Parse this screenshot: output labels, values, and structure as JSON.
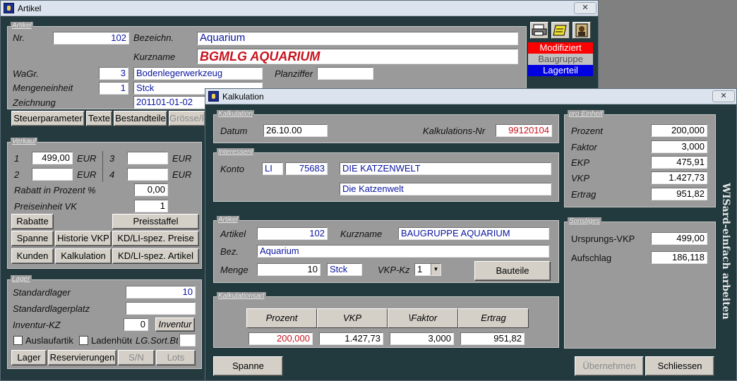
{
  "artikel_window": {
    "title": "Artikel",
    "close": "✕",
    "group_artikel": "Artikel",
    "nr_label": "Nr.",
    "nr_value": "102",
    "bezeichn_label": "Bezeichn.",
    "bezeichn_value": "Aquarium",
    "kurzname_label": "Kurzname",
    "kurzname_value": "BGMLG AQUARIUM",
    "wagr_label": "WaGr.",
    "wagr_value": "3",
    "wagr_text": "Bodenlegerwerkzeug",
    "planziffer_label": "Planziffer",
    "planziffer_value": "",
    "mengeneinheit_label": "Mengeneinheit",
    "mengeneinheit_value": "1",
    "mengeneinheit_text": "Stck",
    "zeichnung_label": "Zeichnung",
    "zeichnung_value": "201101-01-02",
    "tabs": [
      "Steuerparameter",
      "Texte",
      "Bestandteile",
      "Grösse/F"
    ],
    "status": {
      "modifiziert": "Modifiziert",
      "baugruppe": "Baugruppe",
      "lagerteil": "Lagerteil"
    },
    "verkauf": {
      "legend": "Verkauf",
      "p1_label": "1",
      "p1_value": "499,00",
      "p1_unit": "EUR",
      "p2_label": "2",
      "p2_value": "",
      "p2_unit": "EUR",
      "p3_label": "3",
      "p3_value": "",
      "p3_unit": "EUR",
      "p4_label": "4",
      "p4_value": "",
      "p4_unit": "EUR",
      "rabatt_label": "Rabatt in Prozent %",
      "rabatt_value": "0,00",
      "preiseinheit_label": "Preiseinheit VK",
      "preiseinheit_value": "1",
      "buttons": {
        "rabatte": "Rabatte",
        "preisstaffel": "Preisstaffel",
        "spanne": "Spanne",
        "historie": "Historie VKP",
        "kdli_preise": "KD/LI-spez. Preise",
        "kunden": "Kunden",
        "kalkulation": "Kalkulation",
        "kdli_artikel": "KD/LI-spez. Artikel"
      }
    },
    "lager": {
      "legend": "Lager",
      "standardlager_label": "Standardlager",
      "standardlager_value": "10",
      "lagerplatz_label": "Standardlagerplatz",
      "lagerplatz_value": "",
      "inventur_kz_label": "Inventur-KZ",
      "inventur_kz_value": "0",
      "inventur_button": "Inventur",
      "auslauf_label": "Auslaufartik",
      "ladenhueter_label": "Ladenhüte",
      "lgsort_label": "LG.Sort.Bt",
      "buttons": {
        "lager": "Lager",
        "reservierungen": "Reservierungen",
        "sn": "S/N",
        "lots": "Lots"
      }
    }
  },
  "kalkulation_window": {
    "title": "Kalkulation",
    "close": "✕",
    "kalk_group": {
      "legend": "Kalkulation",
      "datum_label": "Datum",
      "datum_value": "26.10.00",
      "nr_label": "Kalkulations-Nr",
      "nr_value": "99120104"
    },
    "interessent": {
      "legend": "Interessent",
      "konto_label": "Konto",
      "konto_prefix": "LI",
      "konto_nr": "75683",
      "name1": "DIE KATZENWELT",
      "name2": "Die Katzenwelt"
    },
    "artikel": {
      "legend": "Artikel",
      "artikel_label": "Artikel",
      "artikel_value": "102",
      "kurzname_label": "Kurzname",
      "kurzname_value": "BAUGRUPPE AQUARIUM",
      "bez_label": "Bez.",
      "bez_value": "Aquarium",
      "menge_label": "Menge",
      "menge_value": "10",
      "menge_unit": "Stck",
      "vkpkz_label": "VKP-Kz",
      "vkpkz_value": "1",
      "bauteile_button": "Bauteile"
    },
    "kalkart": {
      "legend": "Kalkulationsart",
      "headers": [
        "Prozent",
        "VKP",
        "\\Faktor",
        "Ertrag"
      ],
      "values": [
        "200,000",
        "1.427,73",
        "3,000",
        "951,82"
      ]
    },
    "pro_einheit": {
      "legend": "pro Einheit",
      "rows": [
        {
          "label": "Prozent",
          "value": "200,000"
        },
        {
          "label": "Faktor",
          "value": "3,000"
        },
        {
          "label": "EKP",
          "value": "475,91"
        },
        {
          "label": "VKP",
          "value": "1.427,73"
        },
        {
          "label": "Ertrag",
          "value": "951,82"
        }
      ]
    },
    "sonstiges": {
      "legend": "Sonstiges",
      "ursprung_label": "Ursprungs-VKP",
      "ursprung_value": "499,00",
      "aufschlag_label": "Aufschlag",
      "aufschlag_value": "186,118"
    },
    "buttons": {
      "spanne": "Spanne",
      "uebernehmen": "Übernehmen",
      "schliessen": "Schliessen"
    },
    "vertical_brand": "WISard-einfach arbeiten"
  },
  "colors": {
    "window_bg": "#243a3e",
    "panel_bg": "#9a9a9a",
    "modifiziert": "#ff0000",
    "baugruppe": "#c0c0c0",
    "lagerteil": "#0000e0"
  }
}
